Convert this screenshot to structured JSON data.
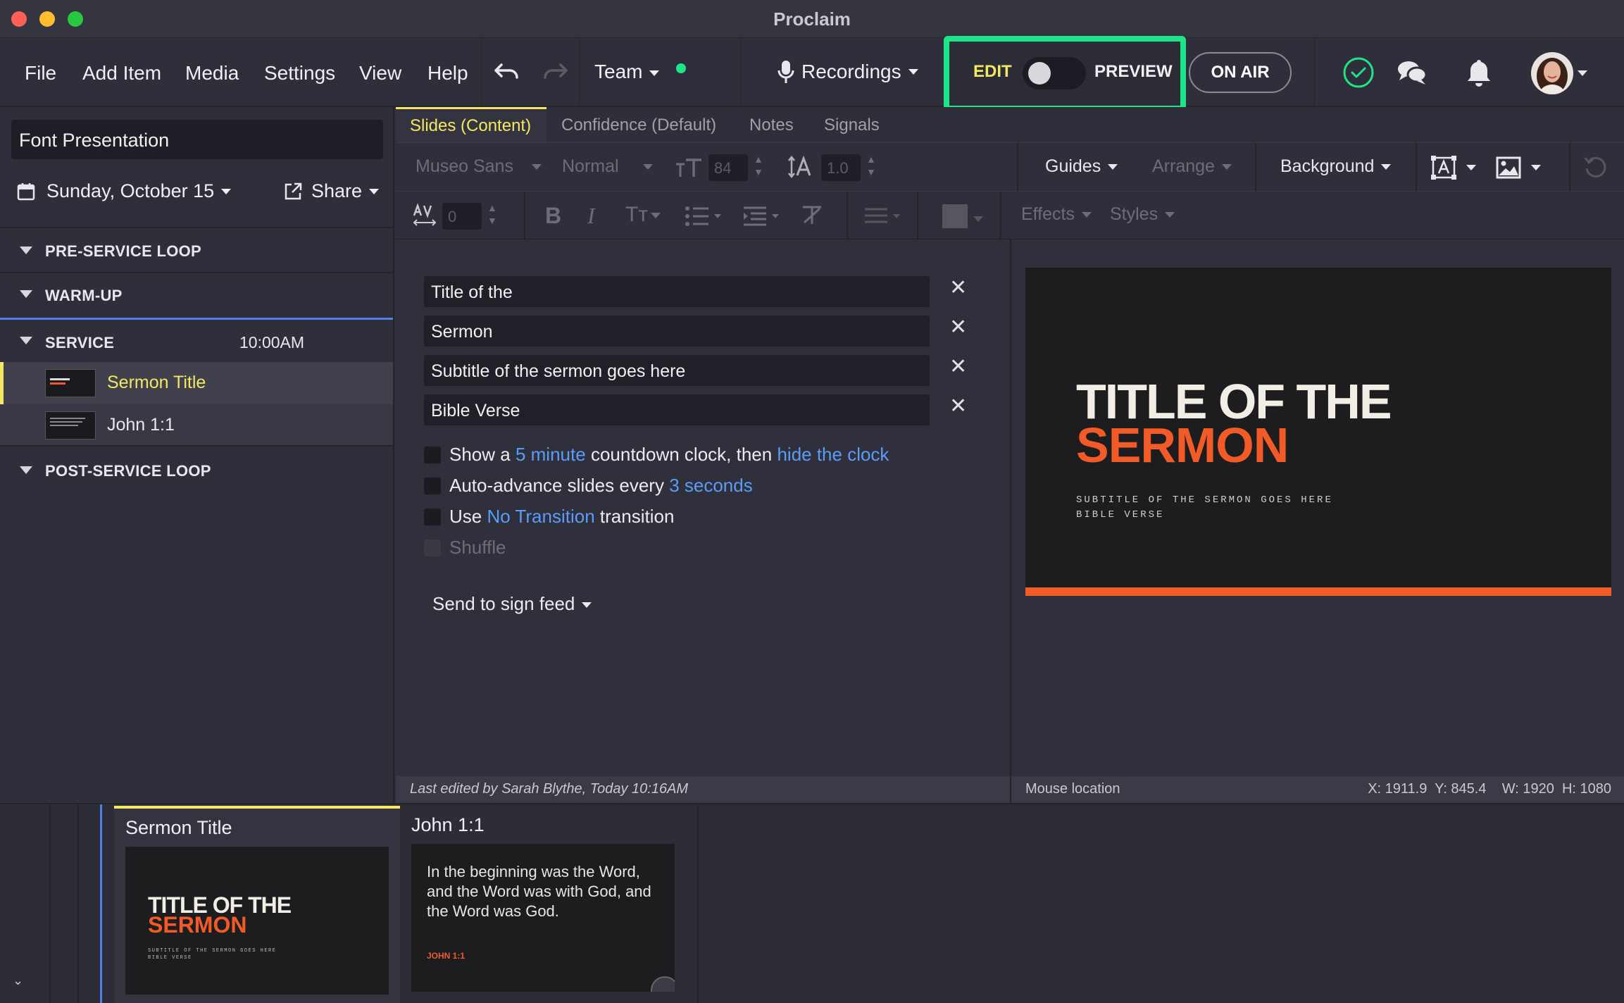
{
  "window": {
    "title": "Proclaim"
  },
  "menu": {
    "file": "File",
    "add_item": "Add Item",
    "media": "Media",
    "settings": "Settings",
    "view": "View",
    "help": "Help",
    "team": "Team",
    "recordings": "Recordings",
    "edit": "EDIT",
    "preview": "PREVIEW",
    "on_air": "ON AIR"
  },
  "sidebar": {
    "presentation_name": "Font Presentation",
    "date": "Sunday, October 15",
    "share": "Share",
    "sections": [
      {
        "label": "PRE-SERVICE LOOP"
      },
      {
        "label": "WARM-UP"
      },
      {
        "label": "SERVICE",
        "time": "10:00AM",
        "items": [
          {
            "label": "Sermon Title"
          },
          {
            "label": "John 1:1"
          }
        ]
      },
      {
        "label": "POST-SERVICE LOOP"
      }
    ]
  },
  "editor": {
    "tabs": [
      "Slides (Content)",
      "Confidence (Default)",
      "Notes",
      "Signals"
    ],
    "font_family": "Museo Sans",
    "font_weight": "Normal",
    "font_size": "84",
    "line_height": "1.0",
    "guides": "Guides",
    "arrange": "Arrange",
    "background": "Background",
    "letter_spacing": "0",
    "effects": "Effects",
    "styles": "Styles",
    "fields": [
      "Title of the",
      "Sermon",
      "Subtitle of the sermon goes here",
      "Bible Verse"
    ],
    "countdown": {
      "pre": "Show a",
      "link1": "5 minute",
      "mid": "countdown clock, then",
      "link2": "hide the clock"
    },
    "autoadvance": {
      "pre": "Auto-advance slides every",
      "link": "3 seconds"
    },
    "transition": {
      "pre": "Use",
      "link": "No Transition",
      "post": "transition"
    },
    "shuffle": "Shuffle",
    "send_to_sign": "Send to sign feed",
    "last_edited": "Last edited by Sarah Blythe, Today 10:16AM"
  },
  "preview": {
    "title_line1": "TITLE OF THE",
    "title_line2": "SERMON",
    "subtitle": "SUBTITLE OF THE SERMON GOES HERE",
    "verse": "BIBLE VERSE",
    "mouse_label": "Mouse location",
    "coords": "X: 1911.9  Y: 845.4    W: 1920  H: 1080"
  },
  "strip": {
    "cards": [
      {
        "title": "Sermon Title",
        "line1": "TITLE OF THE",
        "line2": "SERMON",
        "sub": "SUBTITLE OF THE SERMON GOES HERE",
        "verse": "BIBLE VERSE"
      },
      {
        "title": "John 1:1",
        "body": "In the beginning was the Word, and the Word was with God, and the Word was God.",
        "ref": "JOHN 1:1"
      }
    ]
  },
  "colors": {
    "accent_green": "#1ee58a",
    "accent_yellow": "#f5e663",
    "link_blue": "#5a9cf7",
    "slide_orange": "#f25b28"
  }
}
